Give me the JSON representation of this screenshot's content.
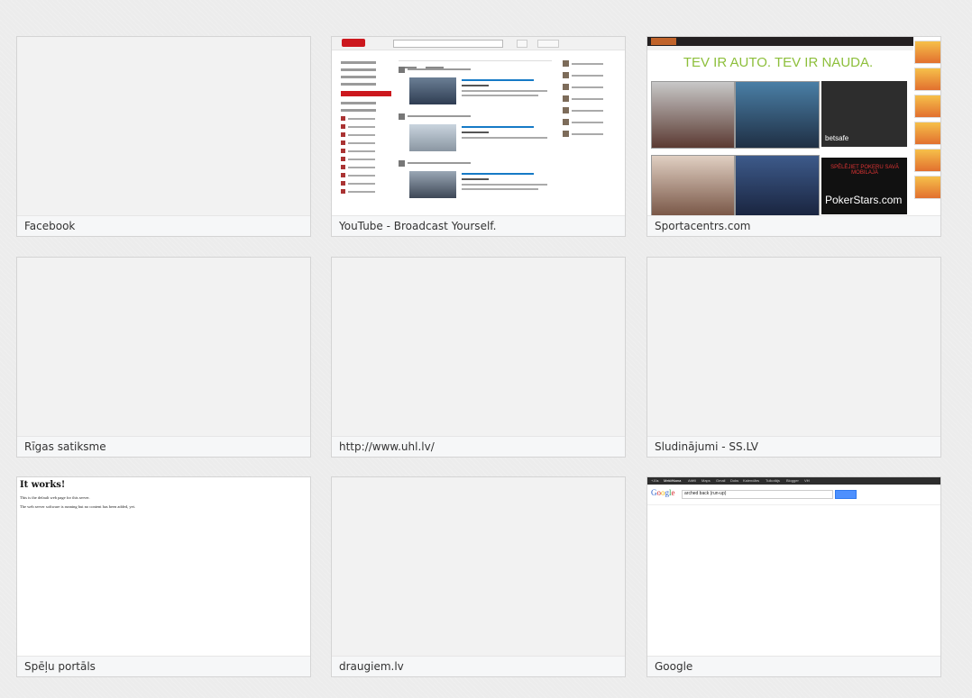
{
  "tiles": [
    {
      "caption": "Facebook"
    },
    {
      "caption": "YouTube - Broadcast Yourself."
    },
    {
      "caption": "Sportacentrs.com"
    },
    {
      "caption": "Rīgas satiksme"
    },
    {
      "caption": "http://www.uhl.lv/"
    },
    {
      "caption": "Sludinājumi - SS.LV"
    },
    {
      "caption": "Spēļu portāls"
    },
    {
      "caption": "draugiem.lv"
    },
    {
      "caption": "Google"
    }
  ],
  "sportacentrs": {
    "headline": "TEV IR AUTO. TEV IR NAUDA.",
    "betsafe": "betsafe",
    "poker_lines": "SPĒLĒJIET POKERU SAVĀ MOBILAJĀ",
    "pokerstars": "PokerStars.com"
  },
  "itworks": {
    "title": "It works!",
    "line1": "This is the default web page for this server.",
    "line2": "The web server software is running but no content has been added, yet."
  },
  "google": {
    "logo": "Google",
    "query": "arched back (run-up)",
    "bar_items": [
      "+Jūs",
      "Meklēšana",
      "Attēli",
      "Maps",
      "Gmail",
      "Doks",
      "Kalendārs",
      "Tulkotājs",
      "Blogger",
      "Vēl"
    ]
  }
}
